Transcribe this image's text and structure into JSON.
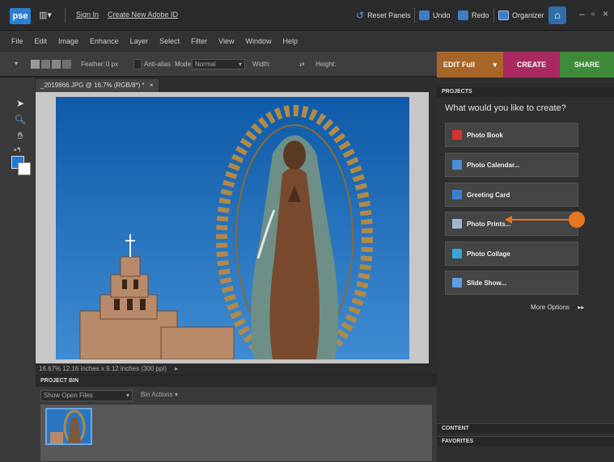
{
  "titlebar": {
    "logo": "pse",
    "sign_in": "Sign In",
    "create_adobe_id": "Create New Adobe ID",
    "reset_panels": "Reset Panels",
    "undo": "Undo",
    "redo": "Redo",
    "organizer": "Organizer"
  },
  "menu": [
    "File",
    "Edit",
    "Image",
    "Enhance",
    "Layer",
    "Select",
    "Filter",
    "View",
    "Window",
    "Help"
  ],
  "options": {
    "feather_label": "Feather:",
    "feather_value": "0 px",
    "antialias": "Anti-alias",
    "mode_label": "Mode:",
    "mode_value": "Normal",
    "width_label": "Width:",
    "height_label": "Height:"
  },
  "modes": {
    "edit": "EDIT Full",
    "create": "CREATE",
    "share": "SHARE"
  },
  "document": {
    "tab_title": "_2019866.JPG @ 16.7% (RGB/8*) *",
    "close": "×",
    "status": "16.67%    12.16 inches x 9.12 inches (300 ppi)"
  },
  "project_bin": {
    "header": "PROJECT BIN",
    "show": "Show Open Files",
    "bin_actions": "Bin Actions"
  },
  "projects": {
    "header": "PROJECTS",
    "question": "What would you like to create?",
    "items": [
      {
        "label": "Photo Book",
        "icon": "photo-book-icon",
        "color": "#d8322d"
      },
      {
        "label": "Photo Calendar...",
        "icon": "calendar-icon",
        "color": "#4a8fd6"
      },
      {
        "label": "Greeting Card",
        "icon": "greeting-card-icon",
        "color": "#3d7fcf"
      },
      {
        "label": "Photo Prints...",
        "icon": "printer-icon",
        "color": "#9fb7cf"
      },
      {
        "label": "Photo Collage",
        "icon": "collage-icon",
        "color": "#3aa4d8"
      },
      {
        "label": "Slide Show...",
        "icon": "slideshow-icon",
        "color": "#5fa0dd"
      }
    ],
    "more_options": "More Options"
  },
  "panels": {
    "content": "CONTENT",
    "favorites": "FAVORITES"
  },
  "colors": {
    "accent_callout": "#e87722",
    "edit_tab": "#a8652a",
    "create_tab": "#a82a61",
    "share_tab": "#3f8a3a",
    "foreground_color": "#1f7ad6"
  }
}
